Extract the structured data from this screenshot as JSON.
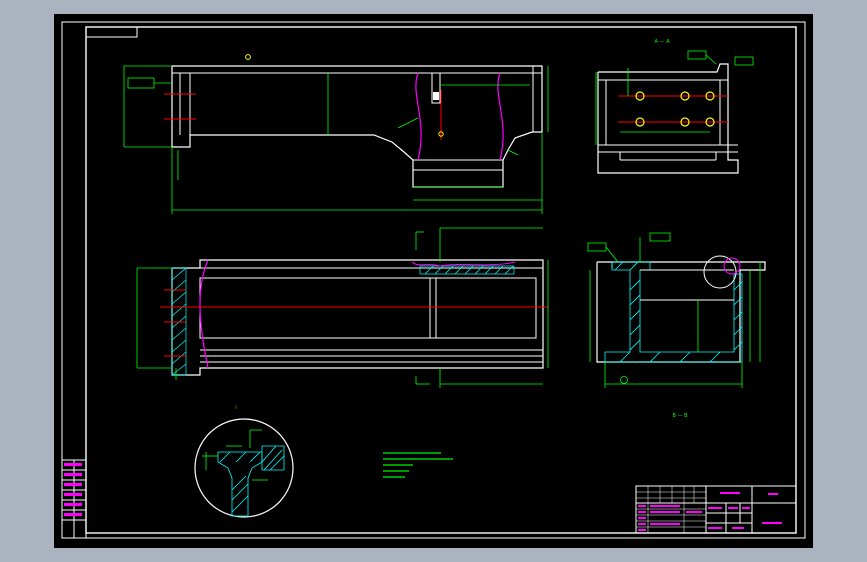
{
  "colors": {
    "background": "#aab3bf",
    "canvas": "#000000",
    "outline": "#ffffff",
    "dimension": "#00ff00",
    "centerline": "#ff0000",
    "break_line": "#ff00ff",
    "hatch": "#00ffff",
    "point": "#ffff00",
    "text": "#00ff00"
  },
  "drawing": {
    "top_left_box": "",
    "section_label_top": "A — A",
    "section_label_bottom": "B — B",
    "detail_label": "I",
    "technical_notes": [
      "",
      "",
      "",
      "",
      ""
    ]
  },
  "title_block": {
    "drawing_name": "",
    "part_title": "",
    "material": "",
    "scale": "",
    "drawing_number": ""
  }
}
